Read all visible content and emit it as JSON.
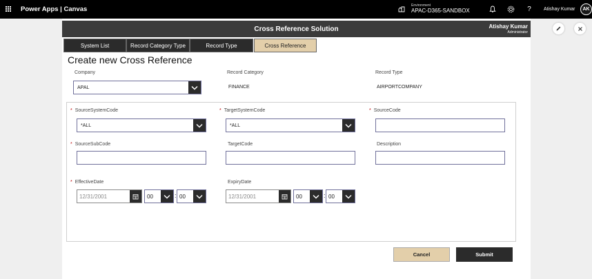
{
  "topbar": {
    "app_name": "Power Apps  |  Canvas",
    "env_label": "Environment",
    "env_name": "APAC-D365-SANDBOX",
    "user_name": "Atishay Kumar",
    "avatar_initials": "AK"
  },
  "app": {
    "header_title": "Cross Reference Solution",
    "header_user": "Atishay Kumar",
    "header_role": "Administrator",
    "tabs": [
      {
        "label": "System List"
      },
      {
        "label": "Record Category Type"
      },
      {
        "label": "Record Type"
      },
      {
        "label": "Cross Reference",
        "active": true
      }
    ],
    "page_title": "Create new Cross Reference",
    "company_label": "Company",
    "company_value": "APAL",
    "record_category_label": "Record Category",
    "record_category_value": "FINANCE",
    "record_type_label": "Record Type",
    "record_type_value": "AIRPORTCOMPANY",
    "required_mark": "*",
    "source_system_code_label": "SourceSystemCode",
    "source_system_code_value": "*ALL",
    "target_system_code_label": "TargetSystemCode",
    "target_system_code_value": "*ALL",
    "source_code_label": "SourceCode",
    "source_sub_code_label": "SourceSubCode",
    "target_code_label": "TargetCode",
    "description_label": "Description",
    "effective_date_label": "EffectiveDate",
    "effective_date_value": "12/31/2001",
    "effective_hour": "00",
    "effective_minute": "00",
    "expiry_date_label": "ExpiryDate",
    "expiry_date_value": "12/31/2001",
    "expiry_hour": "00",
    "expiry_minute": "00",
    "time_separator": ":",
    "cancel_label": "Cancel",
    "submit_label": "Submit"
  },
  "colors": {
    "accent_tan": "#e3cfaa",
    "dark": "#2b2b2b",
    "header": "#3b3b3b"
  }
}
